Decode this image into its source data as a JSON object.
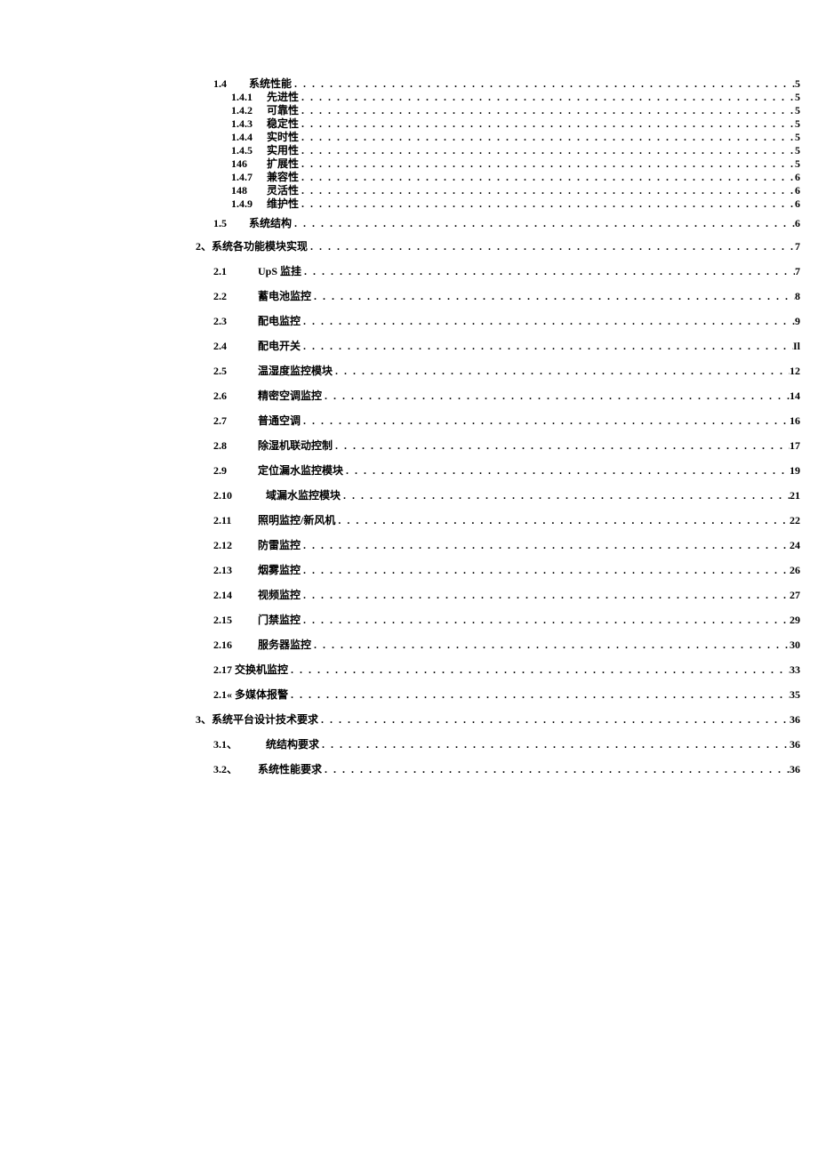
{
  "toc": [
    {
      "cls": "lvl-a",
      "ncls": "w-a",
      "num": "1.4",
      "title": "系统性能",
      "page": "5"
    },
    {
      "cls": "lvl-b",
      "ncls": "w-b",
      "num": "1.4.1",
      "title": "先进性",
      "page": "5"
    },
    {
      "cls": "lvl-b",
      "ncls": "w-b",
      "num": "1.4.2",
      "title": "可靠性",
      "page": "5"
    },
    {
      "cls": "lvl-b",
      "ncls": "w-b",
      "num": "1.4.3",
      "title": "稳定性",
      "page": "5"
    },
    {
      "cls": "lvl-b",
      "ncls": "w-b",
      "num": "1.4.4",
      "title": "实时性",
      "page": "5"
    },
    {
      "cls": "lvl-b",
      "ncls": "w-b",
      "num": "1.4.5",
      "title": "实用性",
      "page": "5"
    },
    {
      "cls": "lvl-b",
      "ncls": "w-b",
      "num": "146",
      "title": "扩展性",
      "page": "5"
    },
    {
      "cls": "lvl-b",
      "ncls": "w-b",
      "num": "1.4.7",
      "title": "兼容性",
      "page": "6"
    },
    {
      "cls": "lvl-b",
      "ncls": "w-b",
      "num": "148",
      "title": "灵活性",
      "page": "6"
    },
    {
      "cls": "lvl-b",
      "ncls": "w-b",
      "num": "1.4.9",
      "title": "维护性",
      "page": "6"
    },
    {
      "cls": "lvl-a",
      "ncls": "w-a",
      "num": "1.5",
      "title": "系统结构",
      "page": "6",
      "gap": 8
    },
    {
      "cls": "lvl-c",
      "ncls": "",
      "num": "2、",
      "title": "系统各功能模块实现",
      "page": "7"
    },
    {
      "cls": "lvl-d",
      "ncls": "w-d",
      "num": "2.1",
      "title": "UpS 监挂",
      "page": "7"
    },
    {
      "cls": "lvl-d",
      "ncls": "w-d",
      "num": "2.2",
      "title": "蓄电池监控",
      "page": "8"
    },
    {
      "cls": "lvl-d",
      "ncls": "w-d",
      "num": "2.3",
      "title": "配电监控",
      "page": "9"
    },
    {
      "cls": "lvl-d",
      "ncls": "w-d",
      "num": "2.4",
      "title": "配电开关",
      "page": "Il"
    },
    {
      "cls": "lvl-d",
      "ncls": "w-d",
      "num": "2.5",
      "title": "温湿度监控模块",
      "page": "12"
    },
    {
      "cls": "lvl-d",
      "ncls": "w-d",
      "num": "2.6",
      "title": "精密空调监控",
      "page": "14"
    },
    {
      "cls": "lvl-d",
      "ncls": "w-d",
      "num": "2.7",
      "title": "普通空调",
      "page": "16"
    },
    {
      "cls": "lvl-d",
      "ncls": "w-d",
      "num": "2.8",
      "title": "除湿机联动控制",
      "page": "17"
    },
    {
      "cls": "lvl-d",
      "ncls": "w-d",
      "num": "2.9",
      "title": "定位漏水监控模块",
      "page": "19"
    },
    {
      "cls": "lvl-d",
      "ncls": "w-d",
      "num": "2.10",
      "title": "   域漏水监控模块",
      "page": "21"
    },
    {
      "cls": "lvl-d",
      "ncls": "w-d",
      "num": "2.11",
      "title": "照明监控/新风机",
      "page": "22"
    },
    {
      "cls": "lvl-d",
      "ncls": "w-d",
      "num": "2.12",
      "title": "防雷监控",
      "page": "24"
    },
    {
      "cls": "lvl-d",
      "ncls": "w-d",
      "num": "2.13",
      "title": "烟雾监控",
      "page": "26"
    },
    {
      "cls": "lvl-d",
      "ncls": "w-d",
      "num": "2.14",
      "title": "视频监控",
      "page": "27"
    },
    {
      "cls": "lvl-d",
      "ncls": "w-d",
      "num": "2.15",
      "title": "门禁监控",
      "page": "29"
    },
    {
      "cls": "lvl-d",
      "ncls": "w-d",
      "num": "2.16",
      "title": "服务器监控",
      "page": "30"
    },
    {
      "cls": "lvl-d",
      "ncls": "",
      "num": "2.17",
      "title": " 交换机监控",
      "page": "33"
    },
    {
      "cls": "lvl-d",
      "ncls": "",
      "num": "2.1«",
      "title": " 多媒体报警",
      "page": "35"
    },
    {
      "cls": "lvl-c",
      "ncls": "",
      "num": "3、",
      "title": "系统平台设计技术要求",
      "page": "36"
    },
    {
      "cls": "lvl-d",
      "ncls": "w-d",
      "num": "3.1、",
      "title": "   统结构要求",
      "page": "36"
    },
    {
      "cls": "lvl-d",
      "ncls": "w-d",
      "num": "3.2、",
      "title": "系统性能要求",
      "page": "36"
    }
  ],
  "dots": ". . . . . . . . . . . . . . . . . . . . . . . . . . . . . . . . . . . . . . . . . . . . . . . . . . . . . . . . . . . . . . . . . . . . . . . . . . . . . . . . . . . . . . . . . . . . . . . . . . . ."
}
